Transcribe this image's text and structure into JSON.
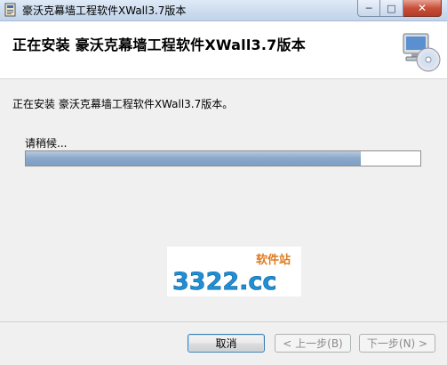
{
  "window": {
    "title": "豪沃克幕墙工程软件XWall3.7版本",
    "minimize_glyph": "─",
    "maximize_glyph": "□",
    "close_glyph": "✕"
  },
  "header": {
    "title": "正在安装 豪沃克幕墙工程软件XWall3.7版本"
  },
  "main": {
    "status_text": "正在安装 豪沃克幕墙工程软件XWall3.7版本。",
    "wait_label": "请稍候...",
    "progress_fraction": 0.85
  },
  "watermark": {
    "logo_text": "3322.cc",
    "tagline": "软件站"
  },
  "footer": {
    "cancel_label": "取消",
    "back_label": "< 上一步(B)",
    "next_label": "下一步(N) >"
  },
  "colors": {
    "progress_fill": "#8aa8ca",
    "primary_border": "#3c7fb1"
  }
}
